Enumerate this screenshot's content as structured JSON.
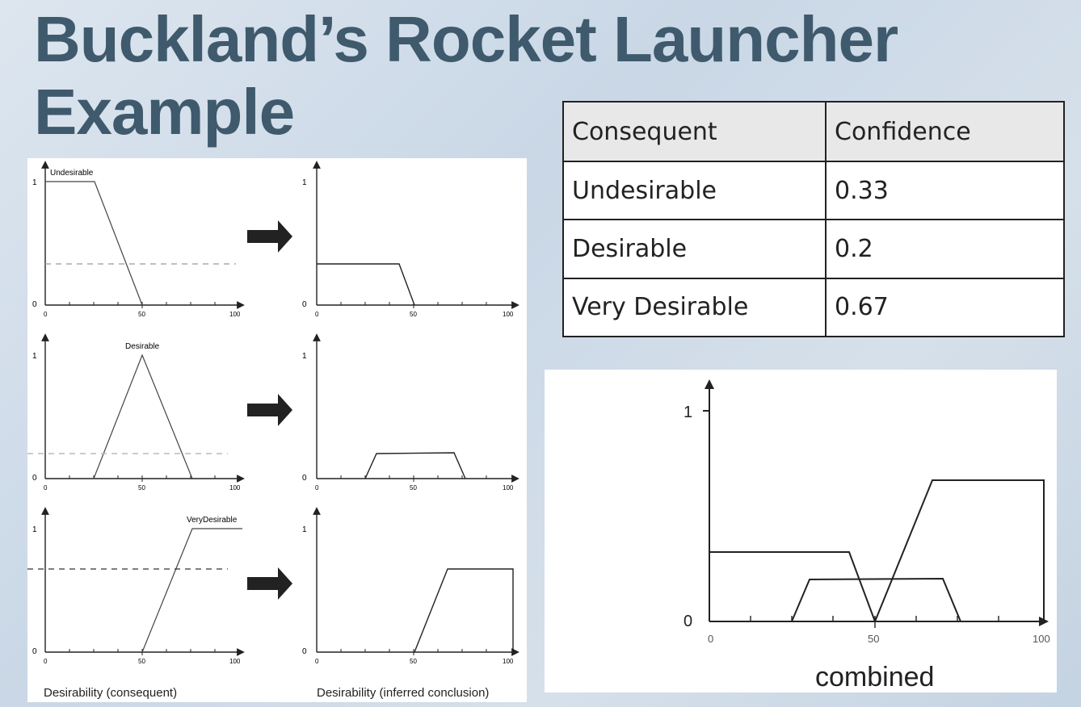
{
  "title": "Buckland’s Rocket Launcher Example",
  "table": {
    "headers": [
      "Consequent",
      "Confidence"
    ],
    "rows": [
      [
        "Undesirable",
        "0.33"
      ],
      [
        "Desirable",
        "0.2"
      ],
      [
        "Very Desirable",
        "0.67"
      ]
    ]
  },
  "small_charts": {
    "tick_labels": {
      "y_top": "1",
      "y_bottom": "0",
      "x0": "0",
      "x50": "50",
      "x100": "100"
    },
    "undesirable_label": "Undesirable",
    "desirable_label": "Desirable",
    "very_desirable_label": "VeryDesirable",
    "left_caption": "Desirability (consequent)",
    "right_caption": "Desirability (inferred conclusion)"
  },
  "combined_chart": {
    "y_top": "1",
    "y_bottom": "0",
    "x0": "0",
    "x50": "50",
    "x100": "100",
    "caption": "combined"
  },
  "colors": {
    "title": "#3f5a6c",
    "arrow": "#222222",
    "line": "#333333"
  }
}
